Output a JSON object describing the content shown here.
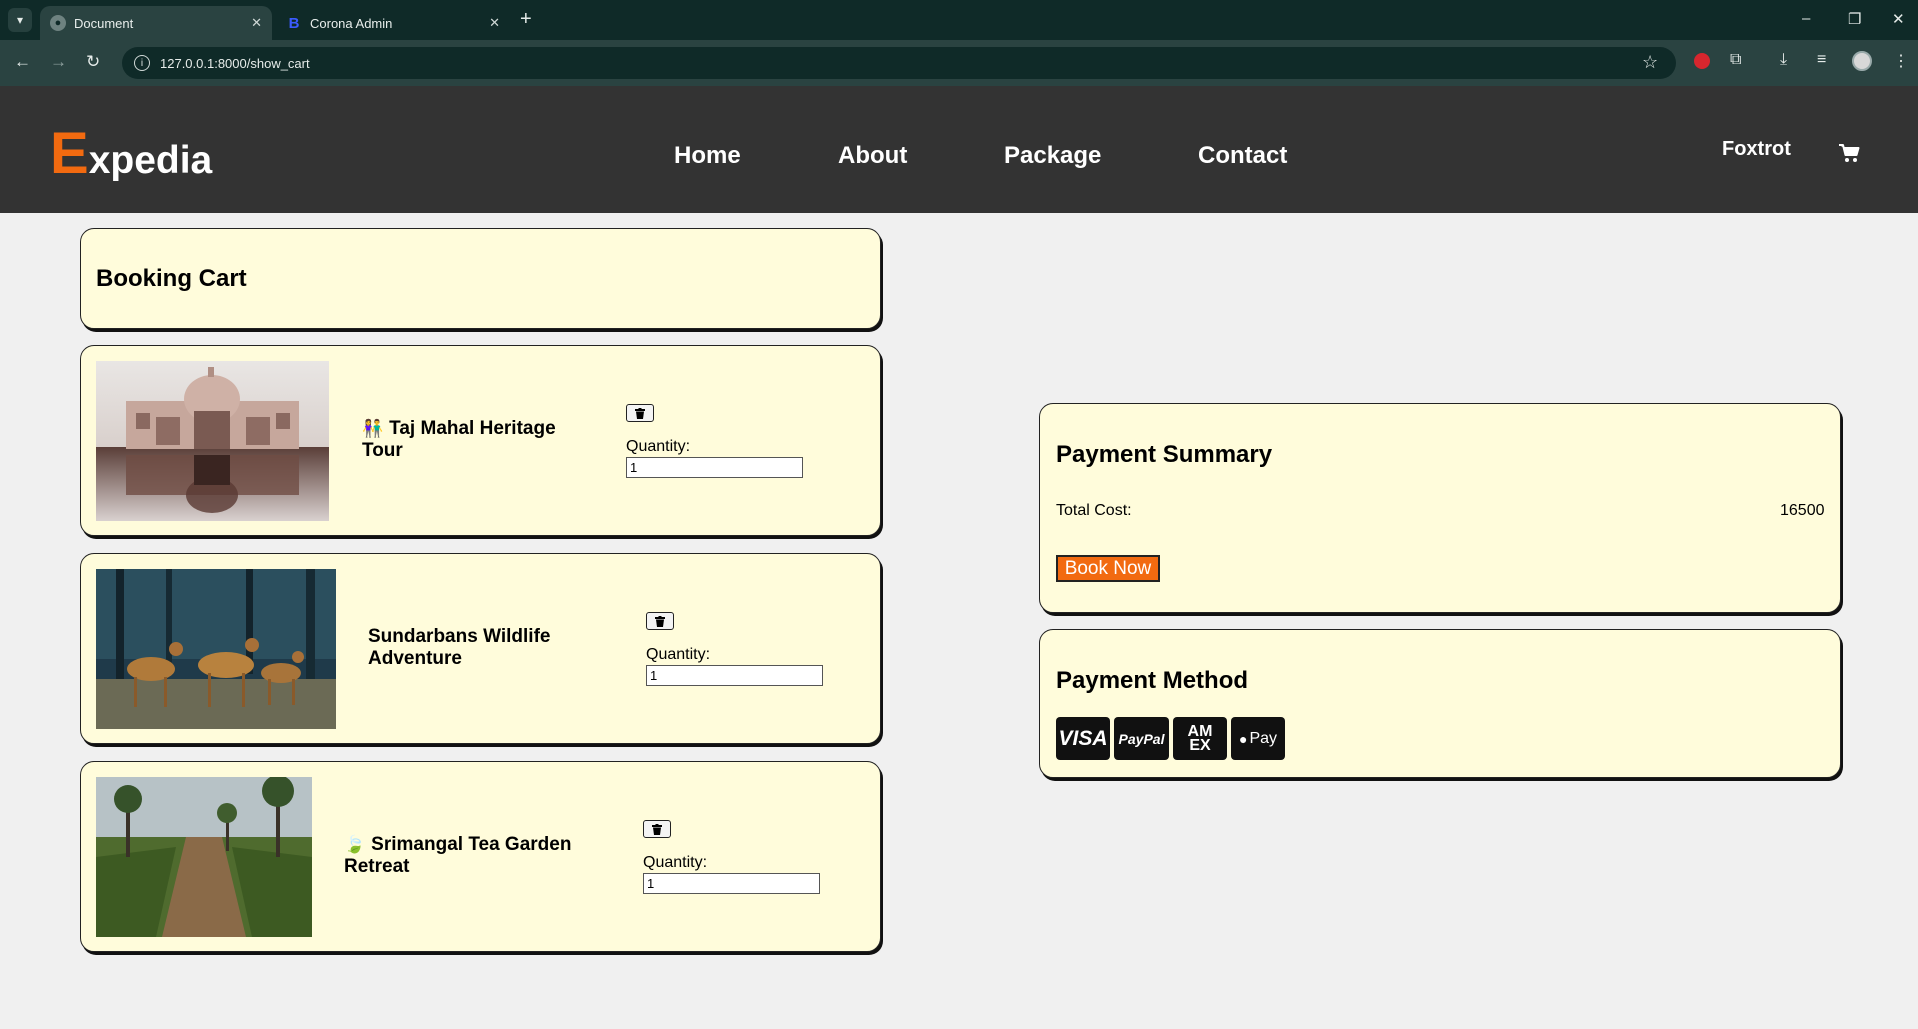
{
  "browser": {
    "tabs": [
      {
        "label": "Document",
        "icon": "globe-icon",
        "active": true
      },
      {
        "label": "Corona Admin",
        "icon": "b-logo-icon",
        "active": false
      }
    ],
    "url": "127.0.0.1:8000/show_cart"
  },
  "site": {
    "logo_first": "E",
    "logo_rest": "xpedia",
    "nav": [
      "Home",
      "About",
      "Package",
      "Contact"
    ],
    "user": "Foxtrot",
    "colors": {
      "header": "#333333",
      "accent": "#f26a10",
      "card": "#fffcdb"
    }
  },
  "cart": {
    "title": "Booking Cart",
    "quantity_label": "Quantity:",
    "items": [
      {
        "emoji": "👫",
        "name": "Taj Mahal Heritage Tour",
        "quantity": "1"
      },
      {
        "emoji": "",
        "name": "Sundarbans Wildlife Adventure",
        "quantity": "1"
      },
      {
        "emoji": "🍃",
        "name": "Srimangal Tea Garden Retreat",
        "quantity": "1"
      }
    ]
  },
  "payment_summary": {
    "title": "Payment Summary",
    "total_label": "Total Cost:",
    "total_value": "16500",
    "book_button": "Book Now"
  },
  "payment_method": {
    "title": "Payment Method",
    "methods": [
      "VISA",
      "PayPal",
      "AM EX",
      "Pay"
    ]
  }
}
